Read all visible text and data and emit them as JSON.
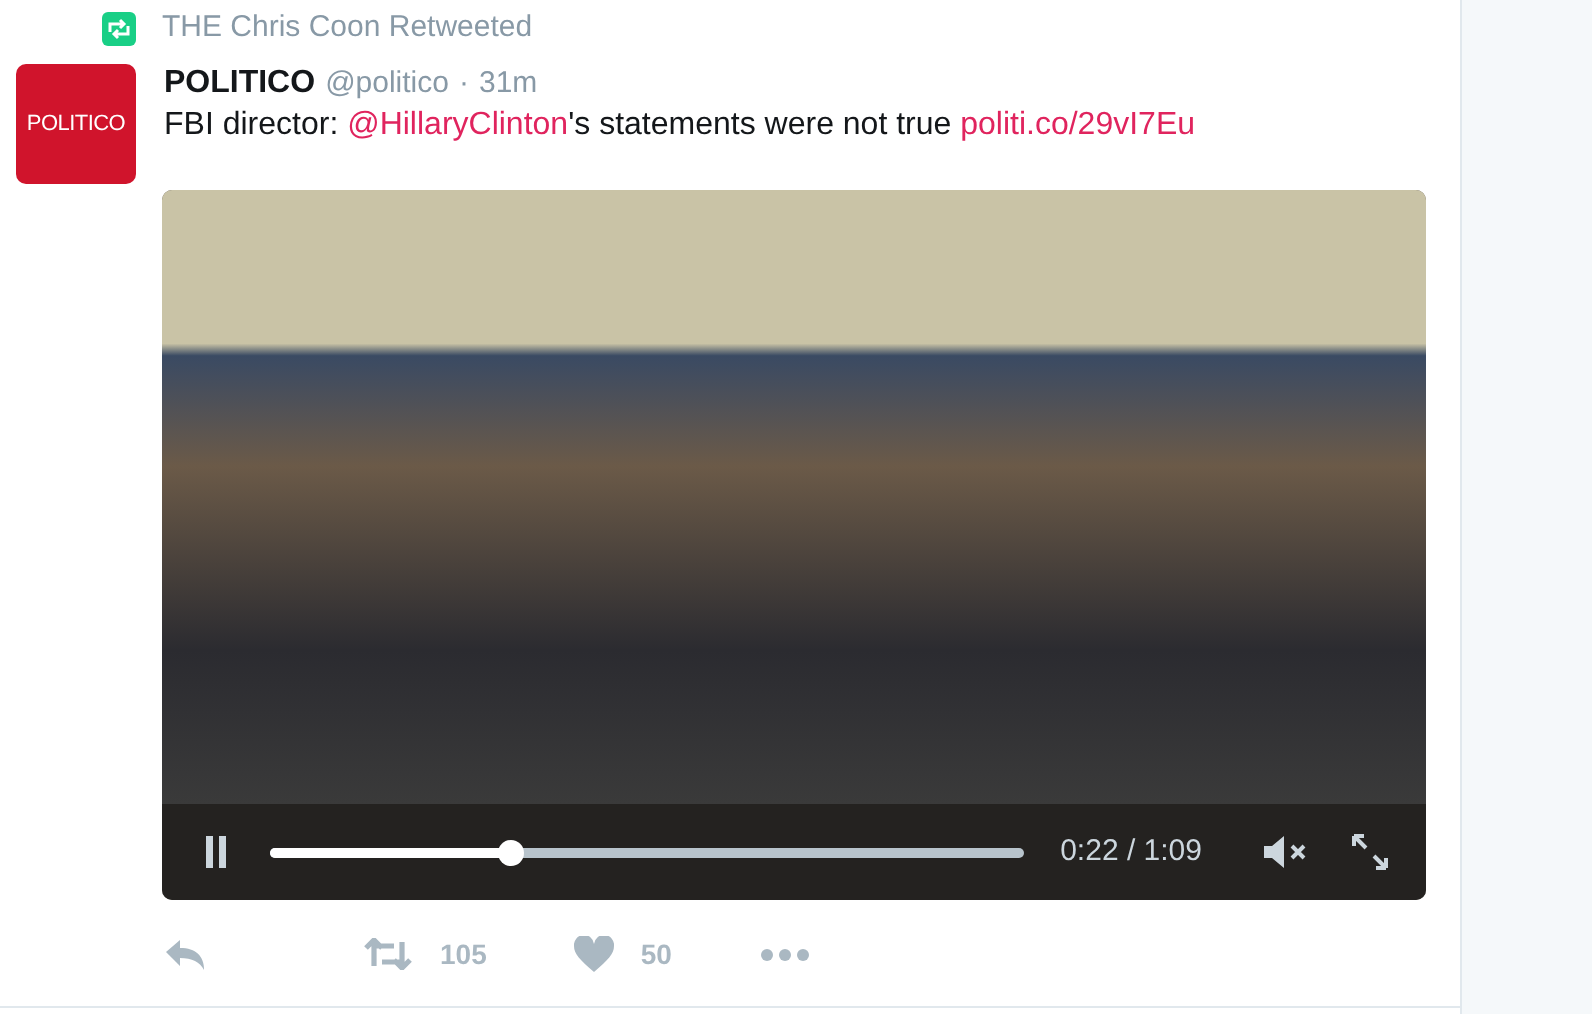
{
  "retweet_note": {
    "text": "THE Chris Coon Retweeted"
  },
  "tweet": {
    "avatar_text": "POLITICO",
    "name": "POLITICO",
    "handle": "@politico",
    "separator": "·",
    "time": "31m",
    "text_parts": [
      {
        "kind": "plain",
        "text": "FBI director: "
      },
      {
        "kind": "mention",
        "text": "@HillaryClinton"
      },
      {
        "kind": "plain",
        "text": "'s statements were not true "
      },
      {
        "kind": "link",
        "text": "politi.co/29vI7Eu"
      }
    ]
  },
  "video": {
    "playing": true,
    "level": 0.32,
    "time": "0:22 / 1:09",
    "muted": true
  },
  "actions": {
    "retweets": "105",
    "likes": "50"
  }
}
